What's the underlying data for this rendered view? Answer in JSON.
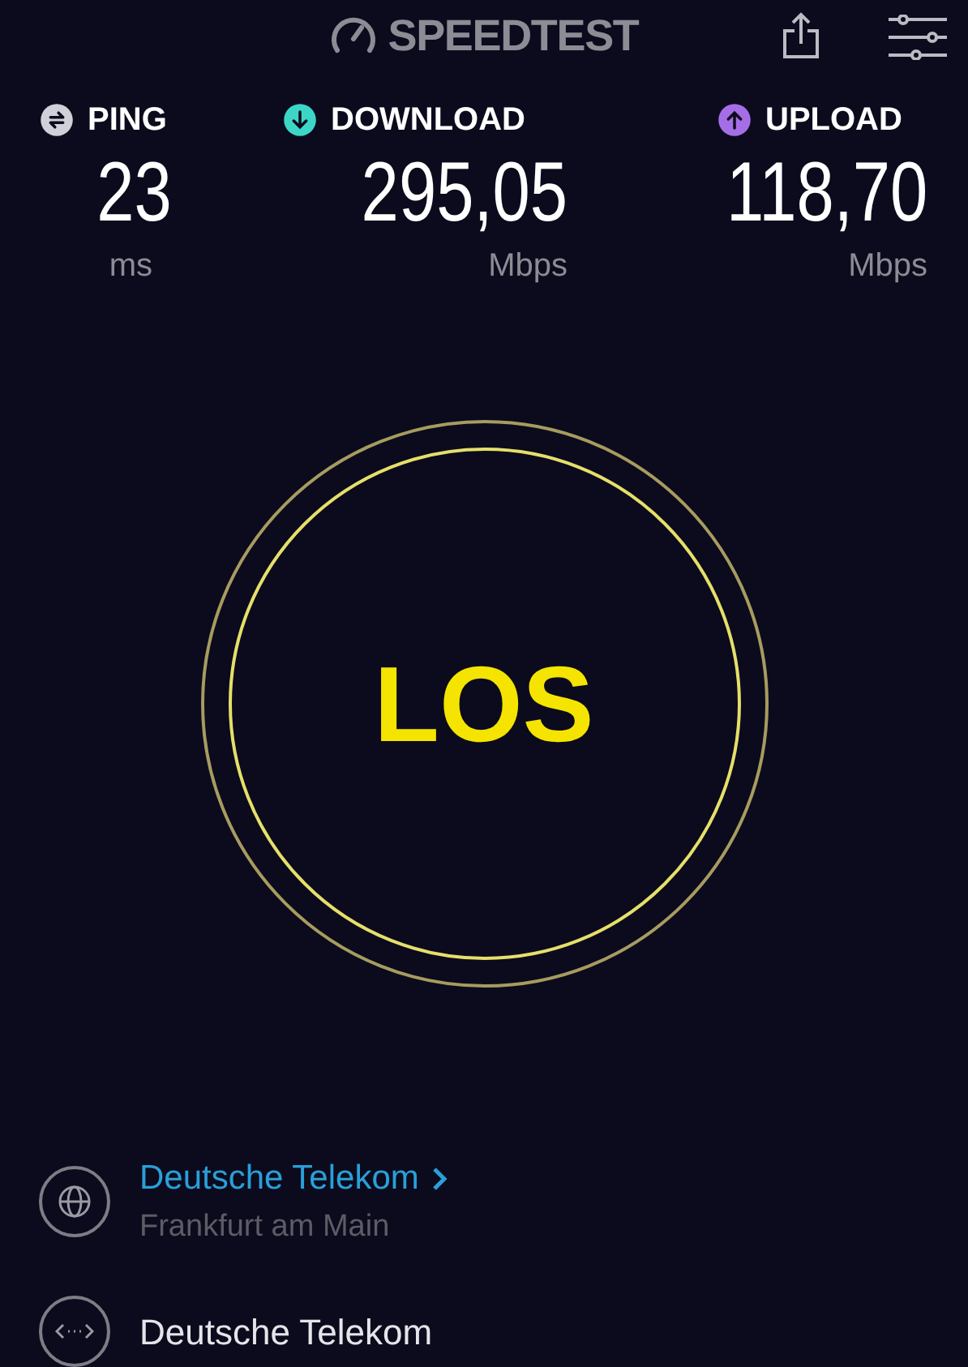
{
  "header": {
    "logo": "SPEEDTEST"
  },
  "metrics": [
    {
      "kind": "ping",
      "label": "PING",
      "value": "23",
      "unit": "ms",
      "color": "#d0d0d8"
    },
    {
      "kind": "download",
      "label": "DOWNLOAD",
      "value": "295,05",
      "unit": "Mbps",
      "color": "#3dd6c6"
    },
    {
      "kind": "upload",
      "label": "UPLOAD",
      "value": "118,70",
      "unit": "Mbps",
      "color": "#a66ee6"
    }
  ],
  "go_button": {
    "label": "LOS"
  },
  "servers": [
    {
      "kind": "server",
      "name": "Deutsche Telekom",
      "location": "Frankfurt am Main"
    },
    {
      "kind": "provider",
      "name": "Deutsche Telekom"
    }
  ]
}
